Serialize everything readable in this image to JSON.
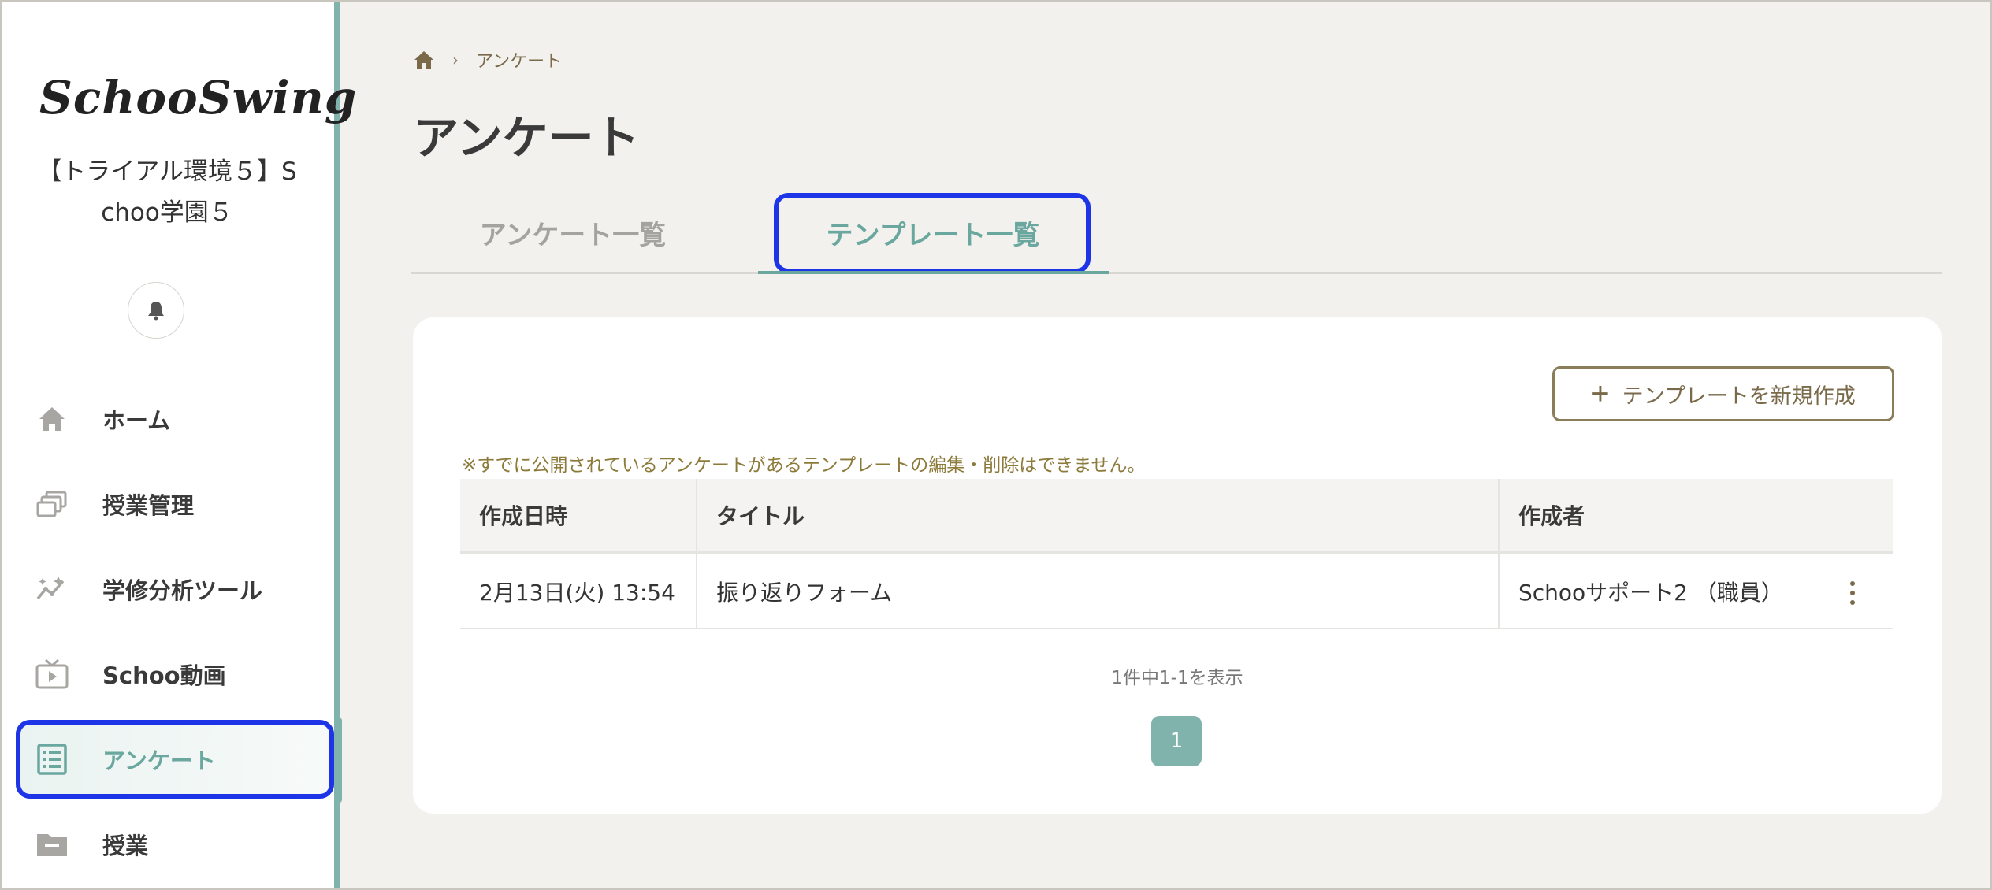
{
  "sidebar": {
    "logo_text": "SchooSwing",
    "org_name_line1": "【トライアル環境５】S",
    "org_name_line2": "choo学園５",
    "items": [
      {
        "label": "ホーム",
        "icon": "home-icon"
      },
      {
        "label": "授業管理",
        "icon": "class-management-icon"
      },
      {
        "label": "学修分析ツール",
        "icon": "analytics-icon"
      },
      {
        "label": "Schoo動画",
        "icon": "tv-icon"
      },
      {
        "label": "アンケート",
        "icon": "survey-list-icon",
        "active": true
      },
      {
        "label": "授業",
        "icon": "folder-icon"
      }
    ]
  },
  "breadcrumb": {
    "current": "アンケート"
  },
  "page_title": "アンケート",
  "tabs": [
    {
      "label": "アンケート一覧"
    },
    {
      "label": "テンプレート一覧",
      "active": true
    }
  ],
  "card": {
    "new_button_label": "テンプレートを新規作成",
    "note": "※すでに公開されているアンケートがあるテンプレートの編集・削除はできません。",
    "table": {
      "headers": [
        "作成日時",
        "タイトル",
        "作成者"
      ],
      "rows": [
        {
          "date": "2月13日(火) 13:54",
          "title": "振り返りフォーム",
          "author": "Schooサポート2 （職員）"
        }
      ]
    },
    "count_text": "1件中1-1を表示",
    "current_page": "1"
  },
  "colors": {
    "accent": "#7fb3ab",
    "highlight": "#1d35e6",
    "brand_text": "#7a6a4a",
    "background": "#f3f1ed"
  }
}
